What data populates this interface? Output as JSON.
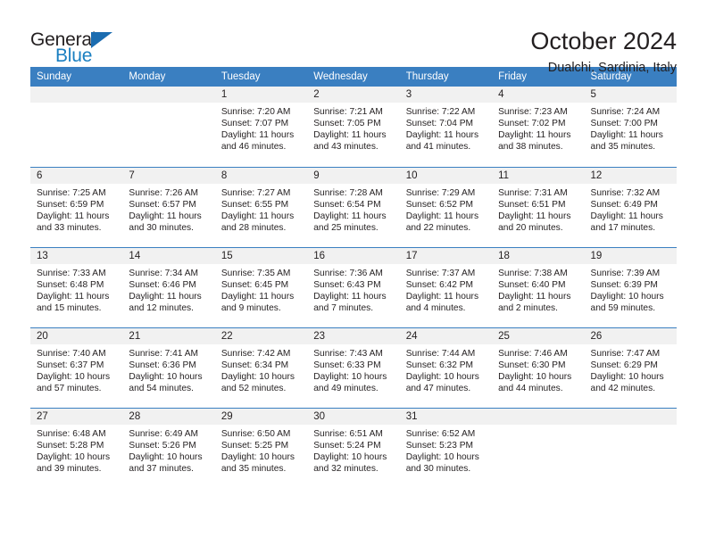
{
  "brand": {
    "name_top": "General",
    "name_bottom": "Blue",
    "accent_color": "#1b6cb0",
    "icon": "triangle-logo"
  },
  "header": {
    "title": "October 2024",
    "subtitle": "Dualchi, Sardinia, Italy"
  },
  "theme": {
    "header_blue": "#3a7fc1",
    "daynum_band": "#f1f1f1",
    "text": "#231f20"
  },
  "weekdays": [
    "Sunday",
    "Monday",
    "Tuesday",
    "Wednesday",
    "Thursday",
    "Friday",
    "Saturday"
  ],
  "labels": {
    "sunrise_prefix": "Sunrise:",
    "sunset_prefix": "Sunset:",
    "daylight_prefix": "Daylight:"
  },
  "weeks": [
    [
      null,
      null,
      {
        "day": "1",
        "sunrise": "Sunrise: 7:20 AM",
        "sunset": "Sunset: 7:07 PM",
        "daylight": "Daylight: 11 hours and 46 minutes."
      },
      {
        "day": "2",
        "sunrise": "Sunrise: 7:21 AM",
        "sunset": "Sunset: 7:05 PM",
        "daylight": "Daylight: 11 hours and 43 minutes."
      },
      {
        "day": "3",
        "sunrise": "Sunrise: 7:22 AM",
        "sunset": "Sunset: 7:04 PM",
        "daylight": "Daylight: 11 hours and 41 minutes."
      },
      {
        "day": "4",
        "sunrise": "Sunrise: 7:23 AM",
        "sunset": "Sunset: 7:02 PM",
        "daylight": "Daylight: 11 hours and 38 minutes."
      },
      {
        "day": "5",
        "sunrise": "Sunrise: 7:24 AM",
        "sunset": "Sunset: 7:00 PM",
        "daylight": "Daylight: 11 hours and 35 minutes."
      }
    ],
    [
      {
        "day": "6",
        "sunrise": "Sunrise: 7:25 AM",
        "sunset": "Sunset: 6:59 PM",
        "daylight": "Daylight: 11 hours and 33 minutes."
      },
      {
        "day": "7",
        "sunrise": "Sunrise: 7:26 AM",
        "sunset": "Sunset: 6:57 PM",
        "daylight": "Daylight: 11 hours and 30 minutes."
      },
      {
        "day": "8",
        "sunrise": "Sunrise: 7:27 AM",
        "sunset": "Sunset: 6:55 PM",
        "daylight": "Daylight: 11 hours and 28 minutes."
      },
      {
        "day": "9",
        "sunrise": "Sunrise: 7:28 AM",
        "sunset": "Sunset: 6:54 PM",
        "daylight": "Daylight: 11 hours and 25 minutes."
      },
      {
        "day": "10",
        "sunrise": "Sunrise: 7:29 AM",
        "sunset": "Sunset: 6:52 PM",
        "daylight": "Daylight: 11 hours and 22 minutes."
      },
      {
        "day": "11",
        "sunrise": "Sunrise: 7:31 AM",
        "sunset": "Sunset: 6:51 PM",
        "daylight": "Daylight: 11 hours and 20 minutes."
      },
      {
        "day": "12",
        "sunrise": "Sunrise: 7:32 AM",
        "sunset": "Sunset: 6:49 PM",
        "daylight": "Daylight: 11 hours and 17 minutes."
      }
    ],
    [
      {
        "day": "13",
        "sunrise": "Sunrise: 7:33 AM",
        "sunset": "Sunset: 6:48 PM",
        "daylight": "Daylight: 11 hours and 15 minutes."
      },
      {
        "day": "14",
        "sunrise": "Sunrise: 7:34 AM",
        "sunset": "Sunset: 6:46 PM",
        "daylight": "Daylight: 11 hours and 12 minutes."
      },
      {
        "day": "15",
        "sunrise": "Sunrise: 7:35 AM",
        "sunset": "Sunset: 6:45 PM",
        "daylight": "Daylight: 11 hours and 9 minutes."
      },
      {
        "day": "16",
        "sunrise": "Sunrise: 7:36 AM",
        "sunset": "Sunset: 6:43 PM",
        "daylight": "Daylight: 11 hours and 7 minutes."
      },
      {
        "day": "17",
        "sunrise": "Sunrise: 7:37 AM",
        "sunset": "Sunset: 6:42 PM",
        "daylight": "Daylight: 11 hours and 4 minutes."
      },
      {
        "day": "18",
        "sunrise": "Sunrise: 7:38 AM",
        "sunset": "Sunset: 6:40 PM",
        "daylight": "Daylight: 11 hours and 2 minutes."
      },
      {
        "day": "19",
        "sunrise": "Sunrise: 7:39 AM",
        "sunset": "Sunset: 6:39 PM",
        "daylight": "Daylight: 10 hours and 59 minutes."
      }
    ],
    [
      {
        "day": "20",
        "sunrise": "Sunrise: 7:40 AM",
        "sunset": "Sunset: 6:37 PM",
        "daylight": "Daylight: 10 hours and 57 minutes."
      },
      {
        "day": "21",
        "sunrise": "Sunrise: 7:41 AM",
        "sunset": "Sunset: 6:36 PM",
        "daylight": "Daylight: 10 hours and 54 minutes."
      },
      {
        "day": "22",
        "sunrise": "Sunrise: 7:42 AM",
        "sunset": "Sunset: 6:34 PM",
        "daylight": "Daylight: 10 hours and 52 minutes."
      },
      {
        "day": "23",
        "sunrise": "Sunrise: 7:43 AM",
        "sunset": "Sunset: 6:33 PM",
        "daylight": "Daylight: 10 hours and 49 minutes."
      },
      {
        "day": "24",
        "sunrise": "Sunrise: 7:44 AM",
        "sunset": "Sunset: 6:32 PM",
        "daylight": "Daylight: 10 hours and 47 minutes."
      },
      {
        "day": "25",
        "sunrise": "Sunrise: 7:46 AM",
        "sunset": "Sunset: 6:30 PM",
        "daylight": "Daylight: 10 hours and 44 minutes."
      },
      {
        "day": "26",
        "sunrise": "Sunrise: 7:47 AM",
        "sunset": "Sunset: 6:29 PM",
        "daylight": "Daylight: 10 hours and 42 minutes."
      }
    ],
    [
      {
        "day": "27",
        "sunrise": "Sunrise: 6:48 AM",
        "sunset": "Sunset: 5:28 PM",
        "daylight": "Daylight: 10 hours and 39 minutes."
      },
      {
        "day": "28",
        "sunrise": "Sunrise: 6:49 AM",
        "sunset": "Sunset: 5:26 PM",
        "daylight": "Daylight: 10 hours and 37 minutes."
      },
      {
        "day": "29",
        "sunrise": "Sunrise: 6:50 AM",
        "sunset": "Sunset: 5:25 PM",
        "daylight": "Daylight: 10 hours and 35 minutes."
      },
      {
        "day": "30",
        "sunrise": "Sunrise: 6:51 AM",
        "sunset": "Sunset: 5:24 PM",
        "daylight": "Daylight: 10 hours and 32 minutes."
      },
      {
        "day": "31",
        "sunrise": "Sunrise: 6:52 AM",
        "sunset": "Sunset: 5:23 PM",
        "daylight": "Daylight: 10 hours and 30 minutes."
      },
      null,
      null
    ]
  ]
}
